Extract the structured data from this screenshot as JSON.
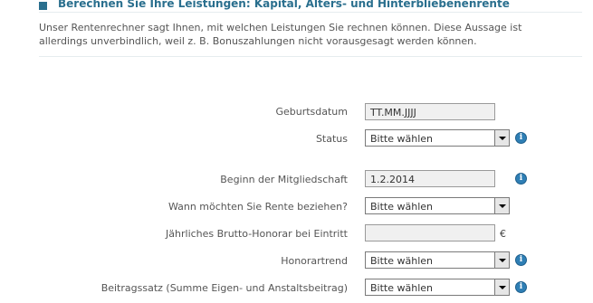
{
  "header": {
    "title": "Berechnen Sie Ihre Leistungen: Kapital, Alters- und Hinterbliebenenrente",
    "intro": "Unser Rentenrechner sagt Ihnen, mit welchen Leistungen Sie rechnen können. Diese Aussage ist allerdings unverbindlich, weil z. B. Bonuszahlungen nicht vorausgesagt werden können."
  },
  "form": {
    "birthdate": {
      "label": "Geburtsdatum",
      "value": "TT.MM.JJJJ"
    },
    "status": {
      "label": "Status",
      "value": "Bitte wählen"
    },
    "membership_start": {
      "label": "Beginn der Mitgliedschaft",
      "value": "1.2.2014"
    },
    "pension_start": {
      "label": "Wann möchten Sie Rente beziehen?",
      "value": "Bitte wählen"
    },
    "annual_fee": {
      "label": "Jährliches Brutto-Honorar bei Eintritt",
      "value": "",
      "currency": "€"
    },
    "fee_trend": {
      "label": "Honorartrend",
      "value": "Bitte wählen"
    },
    "contribution_rate": {
      "label": "Beitragssatz (Summe Eigen- und Anstaltsbeitrag)",
      "value": "Bitte wählen"
    }
  },
  "icons": {
    "info": "info-icon",
    "info_glyph": "i",
    "dropdown": "chevron-down-icon"
  },
  "colors": {
    "accent": "#2a6f8e",
    "info": "#2f7fb5"
  }
}
